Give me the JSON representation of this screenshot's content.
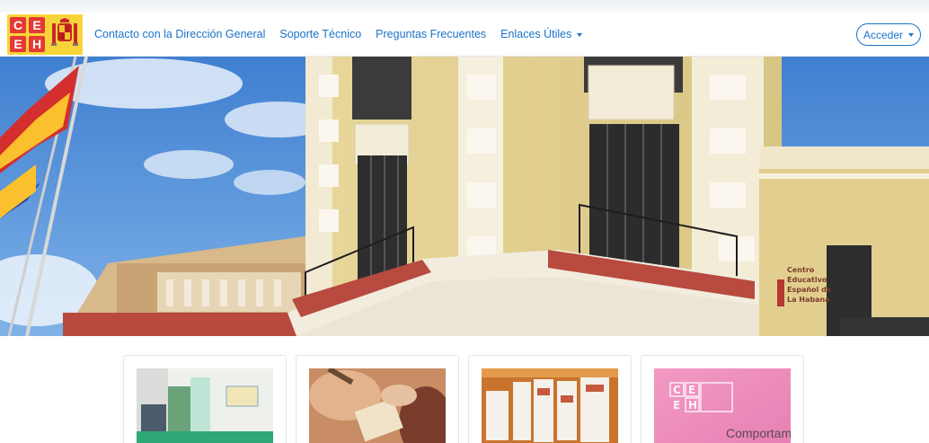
{
  "logo": {
    "letters": [
      "C",
      "E",
      "E",
      "H"
    ],
    "alt": "CEEH"
  },
  "nav": {
    "items": [
      {
        "label": "Contacto con la Dirección General"
      },
      {
        "label": "Soporte Técnico"
      },
      {
        "label": "Preguntas Frecuentes"
      },
      {
        "label": "Enlaces Útiles",
        "dropdown": true
      }
    ],
    "login_label": "Acceder"
  },
  "hero": {
    "sign_lines": [
      "Centro",
      "Educativo",
      "Español de",
      "La Habana"
    ]
  },
  "cards": [
    {
      "name": "card-classroom"
    },
    {
      "name": "card-hands"
    },
    {
      "name": "card-posters"
    },
    {
      "name": "card-comportamiento",
      "overlay_text": "Comportam",
      "logo_letters": [
        "C",
        "E",
        "E",
        "H"
      ]
    }
  ],
  "colors": {
    "link": "#1a73c8",
    "logo_red": "#e53935",
    "logo_yellow": "#f7d53a",
    "card_pink": "#e77fb4"
  }
}
